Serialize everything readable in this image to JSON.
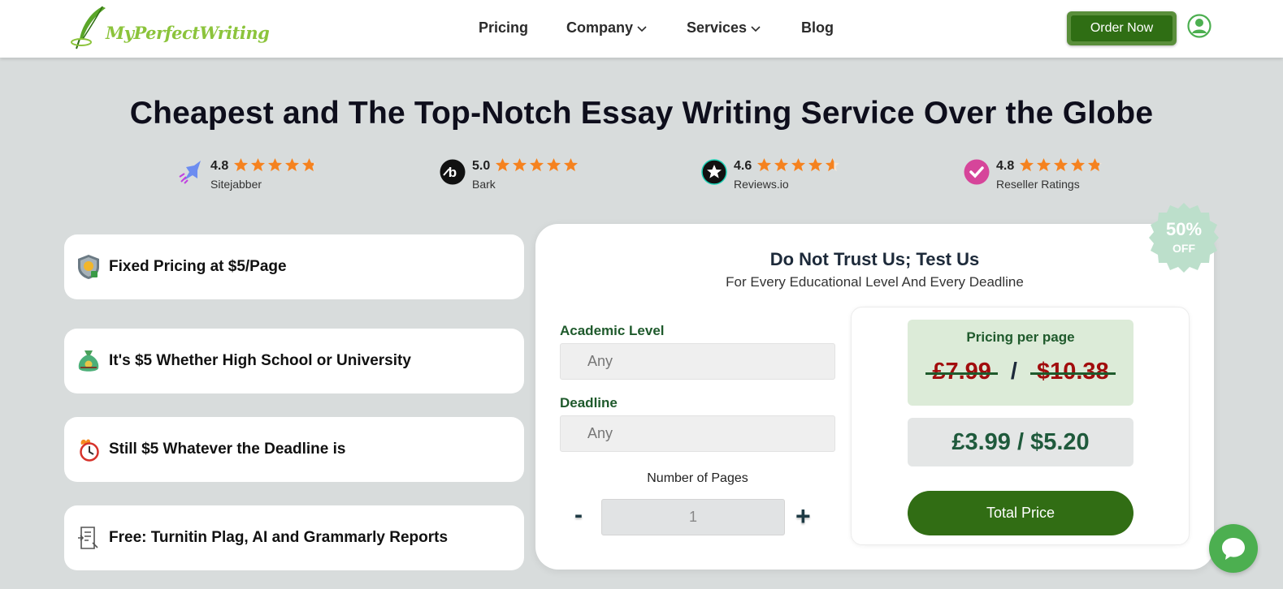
{
  "header": {
    "logo_text": "MyPerfectWriting",
    "nav": [
      {
        "label": "Pricing"
      },
      {
        "label": "Company"
      },
      {
        "label": "Services"
      },
      {
        "label": "Blog"
      }
    ],
    "order_button": "Order Now"
  },
  "hero": {
    "title": "Cheapest and The Top-Notch Essay Writing Service Over the Globe"
  },
  "ratings": [
    {
      "score": "4.8",
      "name": "Sitejabber",
      "stars": 4.8,
      "icon": "sitejabber-icon"
    },
    {
      "score": "5.0",
      "name": "Bark",
      "stars": 5.0,
      "icon": "bark-icon"
    },
    {
      "score": "4.6",
      "name": "Reviews.io",
      "stars": 4.6,
      "icon": "reviews-io-icon"
    },
    {
      "score": "4.8",
      "name": "Reseller Ratings",
      "stars": 4.8,
      "icon": "reseller-ratings-icon"
    }
  ],
  "features": [
    {
      "text": "Fixed Pricing at $5/Page",
      "icon": "price-shield-icon"
    },
    {
      "text": "It's $5 Whether High School or University",
      "icon": "money-bag-icon"
    },
    {
      "text": "Still $5 Whatever the Deadline is",
      "icon": "deadline-clock-icon"
    },
    {
      "text": "Free: Turnitin Plag, AI and Grammarly Reports",
      "icon": "report-icon"
    }
  ],
  "calculator": {
    "title": "Do Not Trust Us; Test Us",
    "subtitle": "For Every Educational Level And Every Deadline",
    "badge_percent": "50%",
    "badge_off": "OFF",
    "academic_level_label": "Academic Level",
    "academic_level_value": "Any",
    "deadline_label": "Deadline",
    "deadline_value": "Any",
    "pages_label": "Number of Pages",
    "pages_value": "1",
    "minus": "-",
    "plus": "+",
    "pricing_label": "Pricing per page",
    "old_price_gbp": "£7.99",
    "old_price_usd": "$10.38",
    "price_separator": "/",
    "new_price": "£3.99 / $5.20",
    "total_button": "Total Price"
  },
  "colors": {
    "brand_green": "#316d14",
    "accent_light_green": "#8cc43c",
    "star_orange": "#f5821f",
    "old_price_red": "#a10d0d",
    "background": "#d8dcdc"
  }
}
